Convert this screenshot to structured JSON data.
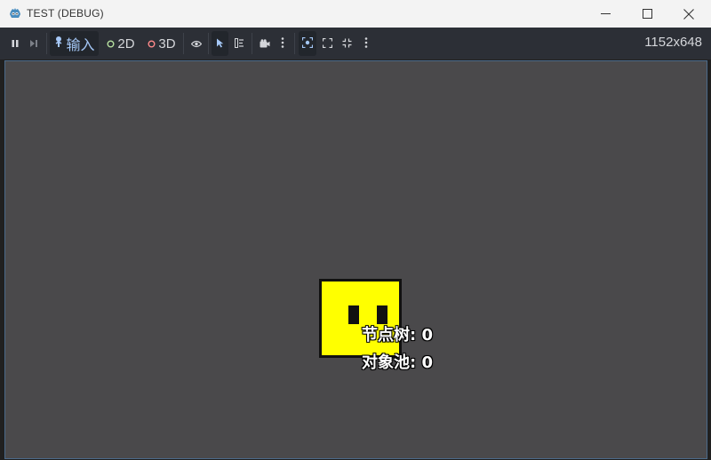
{
  "window": {
    "title": "TEST (DEBUG)",
    "controls": [
      "minimize-icon",
      "maximize-icon",
      "close-icon"
    ]
  },
  "toolbar": {
    "input_label": "输入",
    "mode_2d_label": "2D",
    "mode_3d_label": "3D",
    "resolution_label": "1152x648",
    "icons": [
      "pause-icon",
      "step-icon",
      "input-icon",
      "eye-icon",
      "select-arrow-icon",
      "list-select-icon",
      "camera-icon",
      "more-icon",
      "camera-override-icon",
      "fullscreen-icon",
      "shrink-icon",
      "more-icon"
    ]
  },
  "game": {
    "node_tree_label": "节点树: 0",
    "object_pool_label": "对象池: 0"
  },
  "colors": {
    "viewport_bg": "#4a494b",
    "toolbar_bg": "#2c2f36",
    "player_fill": "#ffff00",
    "accent": "#a5c8f7",
    "mode_2d_dot": "#b6e0a0",
    "mode_3d_dot": "#ff8a8a"
  }
}
